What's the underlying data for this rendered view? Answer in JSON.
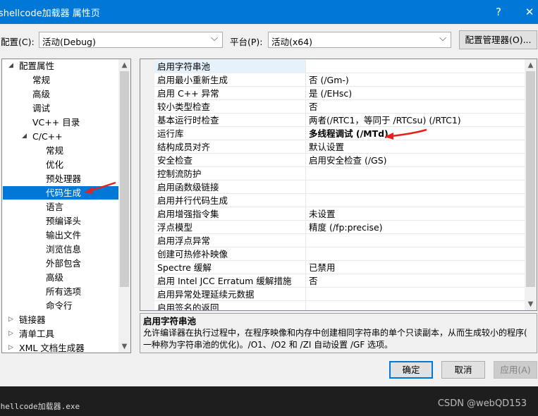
{
  "window": {
    "title": "shellcode加载器 属性页",
    "help_glyph": "?",
    "close_glyph": "✕"
  },
  "config": {
    "config_label": "配置(C):",
    "config_value": "活动(Debug)",
    "platform_label": "平台(P):",
    "platform_value": "活动(x64)",
    "manager_label": "配置管理器(O)..."
  },
  "tree": [
    {
      "label": "配置属性",
      "expander": "◢"
    },
    {
      "label": "常规"
    },
    {
      "label": "高级"
    },
    {
      "label": "调试"
    },
    {
      "label": "VC++ 目录"
    },
    {
      "label": "C/C++",
      "expander": "◢"
    },
    {
      "label": "常规"
    },
    {
      "label": "优化"
    },
    {
      "label": "预处理器"
    },
    {
      "label": "代码生成"
    },
    {
      "label": "语言"
    },
    {
      "label": "预编译头"
    },
    {
      "label": "输出文件"
    },
    {
      "label": "浏览信息"
    },
    {
      "label": "外部包含"
    },
    {
      "label": "高级"
    },
    {
      "label": "所有选项"
    },
    {
      "label": "命令行"
    },
    {
      "label": "链接器",
      "expander": "▷"
    },
    {
      "label": "清单工具",
      "expander": "▷"
    },
    {
      "label": "XML 文档生成器",
      "expander": "▷"
    }
  ],
  "properties": [
    {
      "name": "启用字符串池",
      "value": ""
    },
    {
      "name": "启用最小重新生成",
      "value": "否 (/Gm-)"
    },
    {
      "name": "启用 C++ 异常",
      "value": "是 (/EHsc)"
    },
    {
      "name": "较小类型检查",
      "value": "否"
    },
    {
      "name": "基本运行时检查",
      "value": "两者(/RTC1，等同于 /RTCsu) (/RTC1)"
    },
    {
      "name": "运行库",
      "value": "多线程调试 (/MTd)"
    },
    {
      "name": "结构成员对齐",
      "value": "默认设置"
    },
    {
      "name": "安全检查",
      "value": "启用安全检查 (/GS)"
    },
    {
      "name": "控制流防护",
      "value": ""
    },
    {
      "name": "启用函数级链接",
      "value": ""
    },
    {
      "name": "启用并行代码生成",
      "value": ""
    },
    {
      "name": "启用增强指令集",
      "value": "未设置"
    },
    {
      "name": "浮点模型",
      "value": "精度 (/fp:precise)"
    },
    {
      "name": "启用浮点异常",
      "value": ""
    },
    {
      "name": "创建可热修补映像",
      "value": ""
    },
    {
      "name": "Spectre 缓解",
      "value": "已禁用"
    },
    {
      "name": "启用 Intel JCC Erratum 缓解措施",
      "value": "否"
    },
    {
      "name": "启用异常处理延续元数据",
      "value": ""
    },
    {
      "name": "启用签名的返回",
      "value": ""
    }
  ],
  "description": {
    "title": "启用字符串池",
    "line1": "允许编译器在执行过程中，在程序映像和内存中创建相同字符串的单个只读副本，从而生成较小的程序(",
    "line2": "一种称为字符串池的优化)。/O1、/O2 和 /ZI 自动设置 /GF 选项。"
  },
  "buttons": {
    "ok": "确定",
    "cancel": "取消",
    "apply": "应用(A)"
  },
  "taskbar": {
    "app": "shellcode加载器.exe",
    "watermark": "CSDN @webQD153"
  },
  "colors": {
    "accent": "#0078d7",
    "arrow": "#e8201a"
  }
}
